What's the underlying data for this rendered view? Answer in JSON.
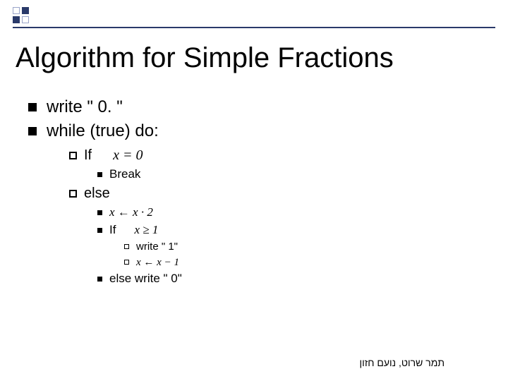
{
  "title": "Algorithm for Simple Fractions",
  "body": {
    "l1a": "write \" 0. \"",
    "l1b": "while (true) do:",
    "l2a_label": "If",
    "l2a_math": "x = 0",
    "l3a": "Break",
    "l2b_label": "else",
    "l3b_math": "x ← x · 2",
    "l3c_label": "If",
    "l3c_math": "x ≥ 1",
    "l4a": "write \" 1\"",
    "l4b_math": "x ← x − 1",
    "l3d": "else write \" 0\""
  },
  "footer": "תמר שרוט, נועם חזון"
}
